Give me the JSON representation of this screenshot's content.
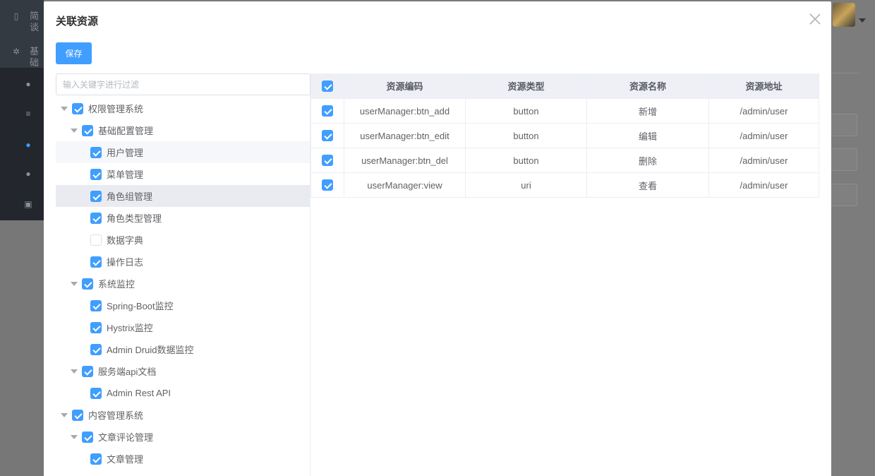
{
  "background": {
    "sidebar_items": [
      {
        "icon": "document-icon",
        "label": "简谈"
      },
      {
        "icon": "gear-icon",
        "label": "基础"
      }
    ]
  },
  "dialog": {
    "title": "关联资源",
    "save_label": "保存",
    "filter_placeholder": "输入关键字进行过滤"
  },
  "tree": [
    {
      "label": "权限管理系统",
      "checked": true,
      "expanded": true,
      "level": 0
    },
    {
      "label": "基础配置管理",
      "checked": true,
      "expanded": true,
      "level": 1
    },
    {
      "label": "用户管理",
      "checked": true,
      "level": 2
    },
    {
      "label": "菜单管理",
      "checked": true,
      "level": 2
    },
    {
      "label": "角色组管理",
      "checked": true,
      "level": 2
    },
    {
      "label": "角色类型管理",
      "checked": true,
      "level": 2
    },
    {
      "label": "数据字典",
      "checked": false,
      "level": 2
    },
    {
      "label": "操作日志",
      "checked": true,
      "level": 2
    },
    {
      "label": "系统监控",
      "checked": true,
      "expanded": true,
      "level": 1
    },
    {
      "label": "Spring-Boot监控",
      "checked": true,
      "level": 2
    },
    {
      "label": "Hystrix监控",
      "checked": true,
      "level": 2
    },
    {
      "label": "Admin Druid数据监控",
      "checked": true,
      "level": 2
    },
    {
      "label": "服务端api文档",
      "checked": true,
      "expanded": true,
      "level": 1
    },
    {
      "label": "Admin Rest API",
      "checked": true,
      "level": 2
    },
    {
      "label": "内容管理系统",
      "checked": true,
      "expanded": true,
      "level": 0
    },
    {
      "label": "文章评论管理",
      "checked": true,
      "expanded": true,
      "level": 1
    },
    {
      "label": "文章管理",
      "checked": true,
      "level": 2
    }
  ],
  "table": {
    "columns": [
      "资源编码",
      "资源类型",
      "资源名称",
      "资源地址"
    ],
    "rows": [
      {
        "code": "userManager:btn_add",
        "type": "button",
        "name": "新增",
        "uri": "/admin/user",
        "checked": true
      },
      {
        "code": "userManager:btn_edit",
        "type": "button",
        "name": "编辑",
        "uri": "/admin/user",
        "checked": true
      },
      {
        "code": "userManager:btn_del",
        "type": "button",
        "name": "删除",
        "uri": "/admin/user",
        "checked": true
      },
      {
        "code": "userManager:view",
        "type": "uri",
        "name": "查看",
        "uri": "/admin/user",
        "checked": true
      }
    ]
  }
}
